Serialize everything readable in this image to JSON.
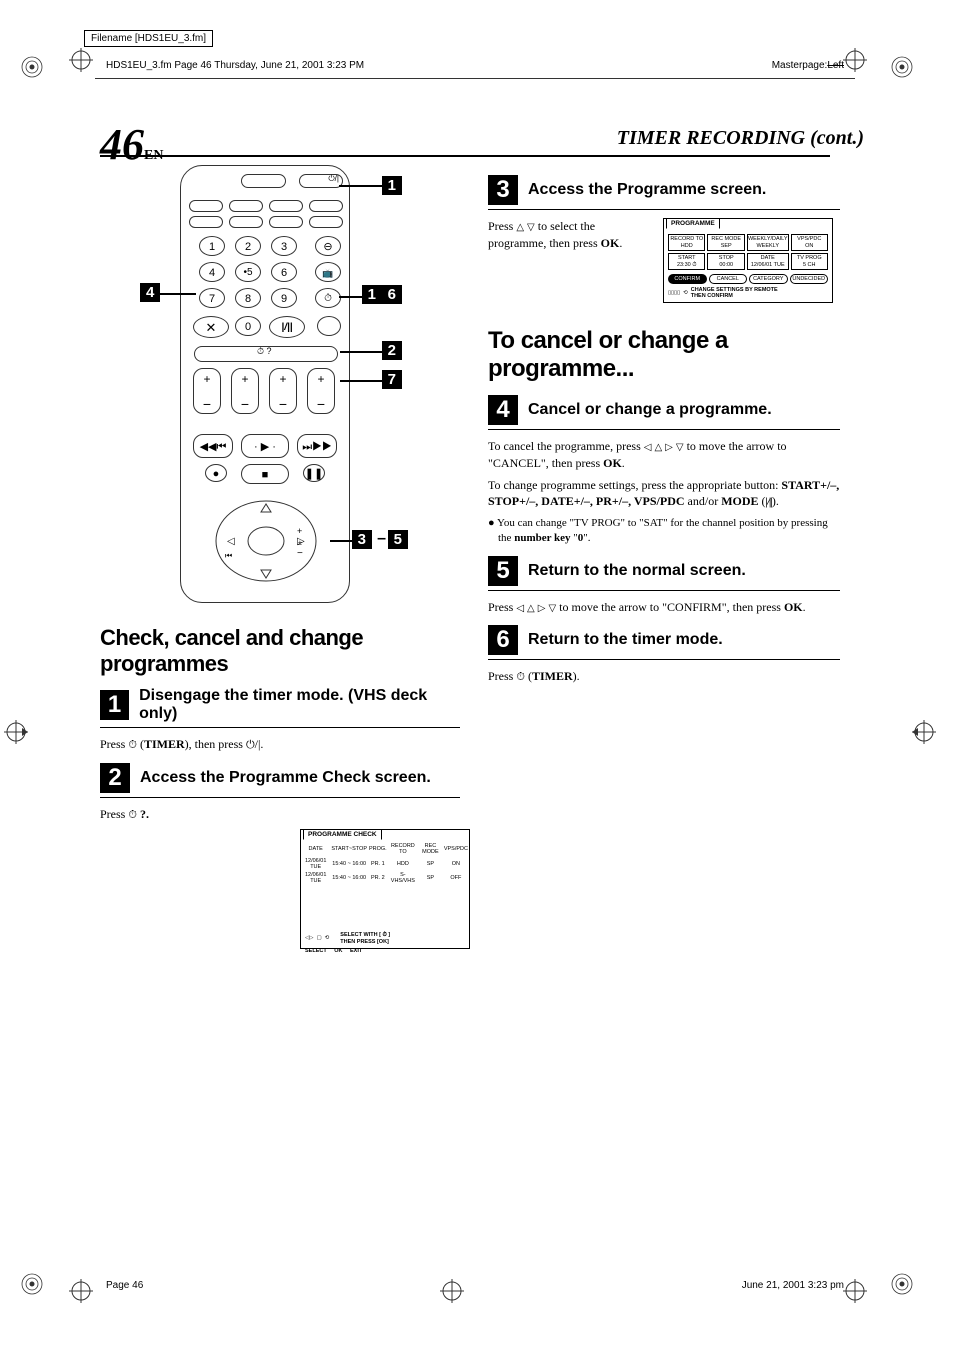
{
  "meta": {
    "filename_label": "Filename [HDS1EU_3.fm]",
    "header_text": "HDS1EU_3.fm  Page 46  Thursday, June 21, 2001  3:23 PM",
    "masterpage_label": "Masterpage:",
    "masterpage_value": "Left",
    "footer_left": "Page 46",
    "footer_right": "June 21, 2001  3:23 pm"
  },
  "page": {
    "number": "46",
    "lang": "EN",
    "section_title": "TIMER RECORDING (cont.)"
  },
  "remote_callouts": {
    "c1": "1",
    "c4": "4",
    "c2": "2",
    "c7": "7",
    "c3": "3",
    "c5": "5",
    "c35_dash": "–",
    "c6_left": "1",
    "c6_right": "6"
  },
  "left": {
    "main_heading": "Check, cancel and change programmes",
    "step1": {
      "num": "1",
      "title": "Disengage the timer mode. (VHS deck only)",
      "body_a": "Press ",
      "body_timer": "TIMER",
      "body_b": "), then press ",
      "body_end": "."
    },
    "step2": {
      "num": "2",
      "title": "Access the Programme Check screen.",
      "body_a": "Press ",
      "body_b": " ?."
    },
    "osd_check": {
      "tab": "PROGRAMME CHECK",
      "headers": [
        "DATE",
        "START~STOP",
        "PROG.",
        "RECORD TO",
        "REC MODE",
        "VPS/PDC"
      ],
      "rows": [
        [
          "12/06/01 TUE",
          "15:40 ~ 16:00",
          "PR. 1",
          "HDD",
          "SP",
          "ON"
        ],
        [
          "12/06/01 TUE",
          "15:40 ~ 16:00",
          "PR. 2",
          "S-VHS/VHS",
          "SP",
          "OFF"
        ]
      ],
      "foot_select": "SELECT",
      "foot_ok": "OK",
      "foot_exit": "EXIT",
      "foot_hint1": "SELECT WITH [ ⏱ ]",
      "foot_hint2": "THEN PRESS [OK]"
    }
  },
  "right": {
    "step3": {
      "num": "3",
      "title": "Access the Programme screen.",
      "body_a": "Press ",
      "body_b": " to select the programme, then press ",
      "ok": "OK",
      "body_c": "."
    },
    "osd_prog": {
      "tab": "PROGRAMME",
      "cells": [
        {
          "l1": "RECORD TO",
          "l2": "HDD"
        },
        {
          "l1": "REC MODE",
          "l2": "SEP"
        },
        {
          "l1": "WEEKLY/DAILY",
          "l2": "WEEKLY"
        },
        {
          "l1": "VPS/PDC",
          "l2": "ON"
        },
        {
          "l1": "START",
          "l2": "23:30 ⏱"
        },
        {
          "l1": "STOP",
          "l2": "00:00"
        },
        {
          "l1": "DATE",
          "l2": "12/06/01 TUE"
        },
        {
          "l1": "TV PROG",
          "l2": "5 CH"
        }
      ],
      "btns": [
        "CONFIRM",
        "CANCEL",
        "CATEGORY",
        "UNDECIDED"
      ],
      "foot_hint1": "CHANGE SETTINGS BY REMOTE",
      "foot_hint2": "THEN CONFIRM"
    },
    "sub_heading": "To cancel or change a programme...",
    "step4": {
      "num": "4",
      "title": "Cancel or change a programme.",
      "p1_a": "To cancel the programme, press ",
      "p1_b": " to move the arrow to \"CANCEL\", then press ",
      "ok": "OK",
      "p1_c": ".",
      "p2_a": "To change programme settings, press the appropriate button: ",
      "p2_list": "START+/–, STOP+/–, DATE+/–, PR+/–, VPS/PDC",
      "p2_b": " and/or ",
      "p2_mode": "MODE",
      "p2_c": " (",
      "p2_d": ").",
      "bullet_a": "You can change \"TV PROG\" to \"SAT\" for the channel position by pressing the ",
      "bullet_b": "number key",
      "bullet_c": " \"",
      "bullet_d": "0",
      "bullet_e": "\"."
    },
    "step5": {
      "num": "5",
      "title": "Return to the normal screen.",
      "body_a": "Press ",
      "body_b": " to move the arrow to \"CONFIRM\", then press ",
      "ok": "OK",
      "body_c": "."
    },
    "step6": {
      "num": "6",
      "title": "Return to the timer mode.",
      "body_a": "Press ",
      "timer": "TIMER",
      "body_b": ")."
    }
  }
}
